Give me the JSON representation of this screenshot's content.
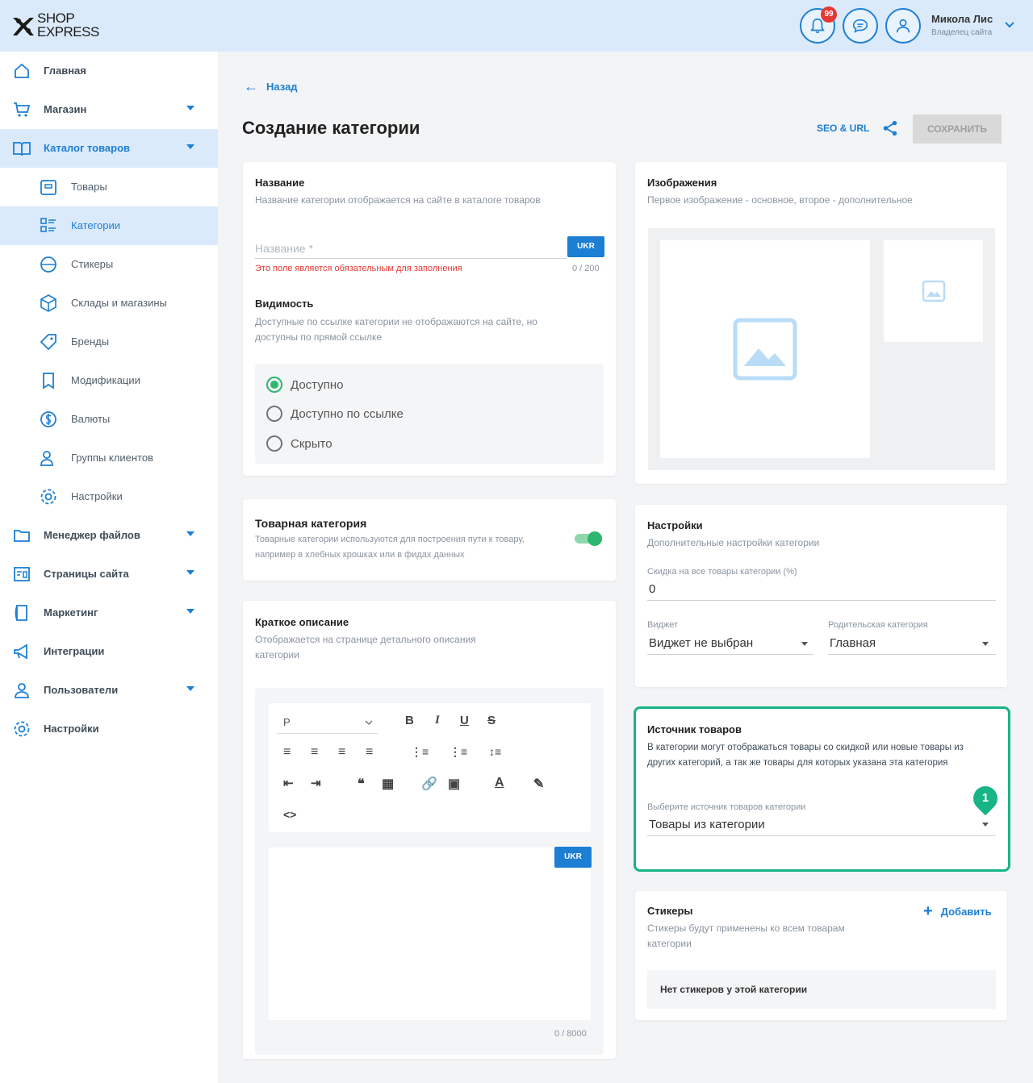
{
  "header": {
    "logo_line1": "SHOP",
    "logo_line2": "EXPRESS",
    "notifications_count": "99",
    "user_name": "Микола Лис",
    "user_role": "Владелец сайта"
  },
  "sidebar": {
    "items": [
      {
        "label": "Главная",
        "icon": "home-icon"
      },
      {
        "label": "Магазин",
        "icon": "cart-icon"
      },
      {
        "label": "Каталог товаров",
        "icon": "book-icon"
      },
      {
        "label": "Товары",
        "icon": "box-icon"
      },
      {
        "label": "Категории",
        "icon": "list-icon"
      },
      {
        "label": "Стикеры",
        "icon": "sticker-icon"
      },
      {
        "label": "Склады и магазины",
        "icon": "cube-icon"
      },
      {
        "label": "Бренды",
        "icon": "tag-icon"
      },
      {
        "label": "Модификации",
        "icon": "bookmark-icon"
      },
      {
        "label": "Валюты",
        "icon": "dollar-icon"
      },
      {
        "label": "Группы клиентов",
        "icon": "users-icon"
      },
      {
        "label": "Настройки",
        "icon": "gear-icon"
      },
      {
        "label": "Менеджер файлов",
        "icon": "folder-icon"
      },
      {
        "label": "Страницы сайта",
        "icon": "pages-icon"
      },
      {
        "label": "Маркетинг",
        "icon": "marketing-icon"
      },
      {
        "label": "Интеграции",
        "icon": "megaphone-icon"
      },
      {
        "label": "Пользователи",
        "icon": "user-icon"
      },
      {
        "label": "Настройки",
        "icon": "gear-icon"
      }
    ]
  },
  "page": {
    "back_label": "Назад",
    "title": "Создание категории",
    "seo_label": "SEO & URL",
    "save_label": "СОХРАНИТЬ"
  },
  "name_card": {
    "title": "Название",
    "subtitle": "Название категории отображается на сайте в каталоге товаров",
    "placeholder": "Название *",
    "lang": "UKR",
    "error": "Это поле является обязательным для заполнения",
    "counter": "0 / 200",
    "visibility_title": "Видимость",
    "visibility_subtitle": "Доступные по ссылке категории не отображаются на сайте, но доступны по прямой ссылке",
    "options": [
      "Доступно",
      "Доступно по ссылке",
      "Скрыто"
    ],
    "selected": "Доступно"
  },
  "product_category_card": {
    "title": "Товарная категория",
    "subtitle": "Товарные категории используются для построения пути к товару, например в хлебных крошках или в фидах данных",
    "toggle_on": true
  },
  "short_desc_card": {
    "title": "Краткое описание",
    "subtitle": "Отображается на странице детального описания категории",
    "format": "P",
    "lang": "UKR",
    "counter": "0 / 8000"
  },
  "images_card": {
    "title": "Изображения",
    "subtitle": "Первое изображение - основное, второе - дополнительное"
  },
  "settings_card": {
    "title": "Настройки",
    "subtitle": "Дополнительные настройки категории",
    "discount_label": "Скидка на все товары категории (%)",
    "discount_value": "0",
    "widget_label": "Виджет",
    "widget_value": "Виджет не выбран",
    "parent_label": "Родительская категория",
    "parent_value": "Главная"
  },
  "source_card": {
    "title": "Источник товаров",
    "description": "В категории могут отображаться товары со скидкой или новые товары из других категорий, а так же товары для которых указана эта категория",
    "select_label": "Выберите источник товаров категории",
    "select_value": "Товары из категории",
    "marker": "1"
  },
  "stickers_card": {
    "title": "Стикеры",
    "subtitle": "Стикеры будут применены ко всем товарам категории",
    "add_label": "Добавить",
    "empty": "Нет стикеров у этой категории"
  },
  "colors": {
    "accent": "#1c7fd4",
    "header_bg": "#dbeafb",
    "highlight": "#17b487",
    "success": "#2db66e",
    "error": "#e53935"
  }
}
